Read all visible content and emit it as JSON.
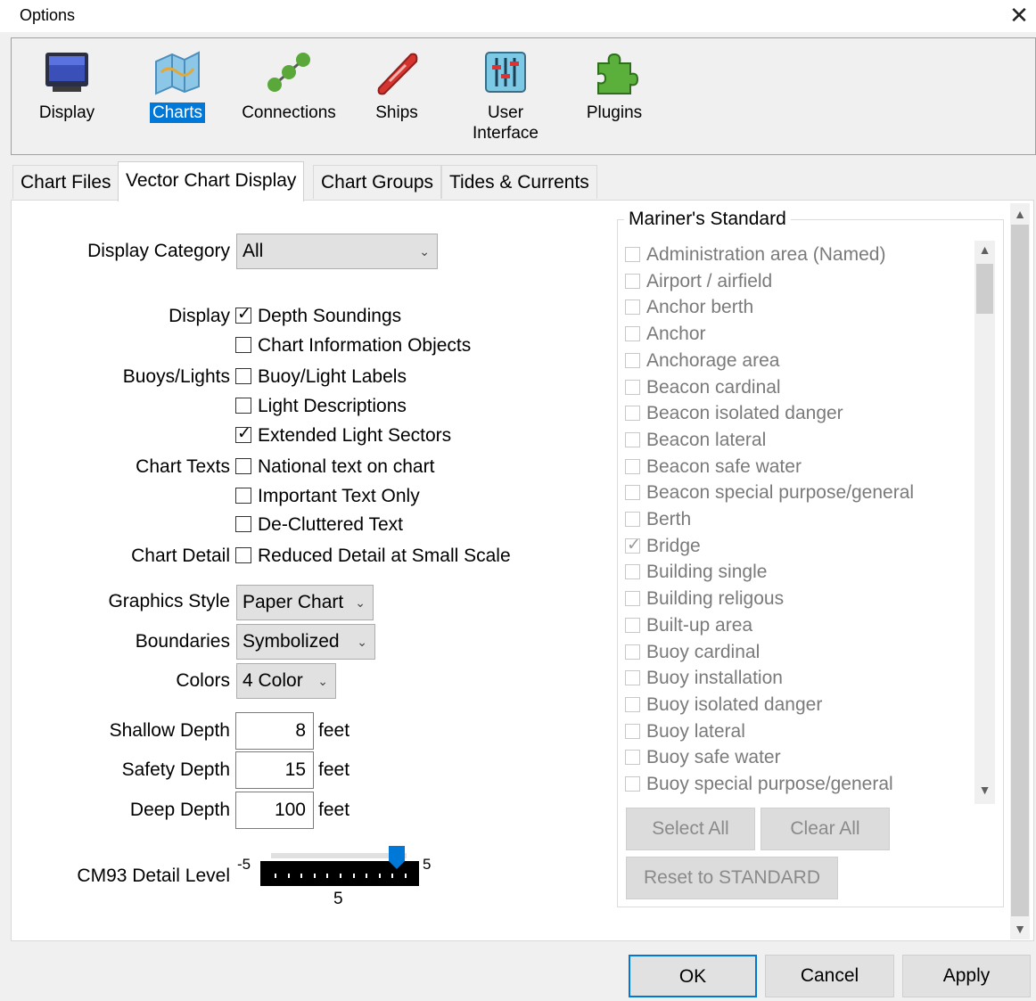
{
  "window": {
    "title": "Options",
    "close_glyph": "✕"
  },
  "toolbar": {
    "items": [
      {
        "label": "Display",
        "icon": "monitor-icon"
      },
      {
        "label": "Charts",
        "icon": "chart-map-icon",
        "selected": true
      },
      {
        "label": "Connections",
        "icon": "connections-icon"
      },
      {
        "label": "Ships",
        "icon": "ship-icon"
      },
      {
        "label": "User\nInterface",
        "label_line1": "User",
        "label_line2": "Interface",
        "icon": "sliders-icon"
      },
      {
        "label": "Plugins",
        "icon": "puzzle-icon"
      }
    ]
  },
  "tabs": [
    "Chart Files",
    "Vector Chart Display",
    "Chart Groups",
    "Tides & Currents"
  ],
  "active_tab": "Vector Chart Display",
  "form": {
    "display_category": {
      "label": "Display Category",
      "value": "All"
    },
    "display": {
      "label": "Display",
      "options": [
        {
          "label": "Depth Soundings",
          "checked": true
        },
        {
          "label": "Chart Information Objects",
          "checked": false
        }
      ]
    },
    "buoys_lights": {
      "label": "Buoys/Lights",
      "options": [
        {
          "label": "Buoy/Light Labels",
          "checked": false
        },
        {
          "label": "Light Descriptions",
          "checked": false
        },
        {
          "label": "Extended Light Sectors",
          "checked": true
        }
      ]
    },
    "chart_texts": {
      "label": "Chart Texts",
      "options": [
        {
          "label": "National text on chart",
          "checked": false
        },
        {
          "label": "Important Text Only",
          "checked": false
        },
        {
          "label": "De-Cluttered Text",
          "checked": false
        }
      ]
    },
    "chart_detail": {
      "label": "Chart Detail",
      "options": [
        {
          "label": "Reduced Detail at Small Scale",
          "checked": false
        }
      ]
    },
    "graphics_style": {
      "label": "Graphics Style",
      "value": "Paper Chart"
    },
    "boundaries": {
      "label": "Boundaries",
      "value": "Symbolized"
    },
    "colors": {
      "label": "Colors",
      "value": "4 Color"
    },
    "shallow_depth": {
      "label": "Shallow Depth",
      "value": "8",
      "unit": "feet"
    },
    "safety_depth": {
      "label": "Safety Depth",
      "value": "15",
      "unit": "feet"
    },
    "deep_depth": {
      "label": "Deep Depth",
      "value": "100",
      "unit": "feet"
    },
    "cm93": {
      "label": "CM93 Detail Level",
      "min": "-5",
      "max": "5",
      "value": "5",
      "fraction": 0.9
    }
  },
  "mariners_standard": {
    "title": "Mariner's Standard",
    "items": [
      {
        "label": "Administration area (Named)",
        "checked": false
      },
      {
        "label": "Airport / airfield",
        "checked": false
      },
      {
        "label": "Anchor berth",
        "checked": false
      },
      {
        "label": "Anchor",
        "checked": false
      },
      {
        "label": "Anchorage area",
        "checked": false
      },
      {
        "label": "Beacon cardinal",
        "checked": false
      },
      {
        "label": "Beacon isolated danger",
        "checked": false
      },
      {
        "label": "Beacon lateral",
        "checked": false
      },
      {
        "label": "Beacon safe water",
        "checked": false
      },
      {
        "label": "Beacon special purpose/general",
        "checked": false
      },
      {
        "label": "Berth",
        "checked": false
      },
      {
        "label": "Bridge",
        "checked": true
      },
      {
        "label": "Building single",
        "checked": false
      },
      {
        "label": "Building religous",
        "checked": false
      },
      {
        "label": "Built-up area",
        "checked": false
      },
      {
        "label": "Buoy cardinal",
        "checked": false
      },
      {
        "label": "Buoy installation",
        "checked": false
      },
      {
        "label": "Buoy isolated danger",
        "checked": false
      },
      {
        "label": "Buoy lateral",
        "checked": false
      },
      {
        "label": "Buoy safe water",
        "checked": false
      },
      {
        "label": "Buoy special purpose/general",
        "checked": false
      }
    ],
    "select_all": "Select All",
    "clear_all": "Clear All",
    "reset": "Reset to STANDARD"
  },
  "dialog_buttons": {
    "ok": "OK",
    "cancel": "Cancel",
    "apply": "Apply"
  },
  "colors": {
    "accent": "#0078d7",
    "panel": "#ffffff",
    "chrome": "#f0f0f0"
  }
}
